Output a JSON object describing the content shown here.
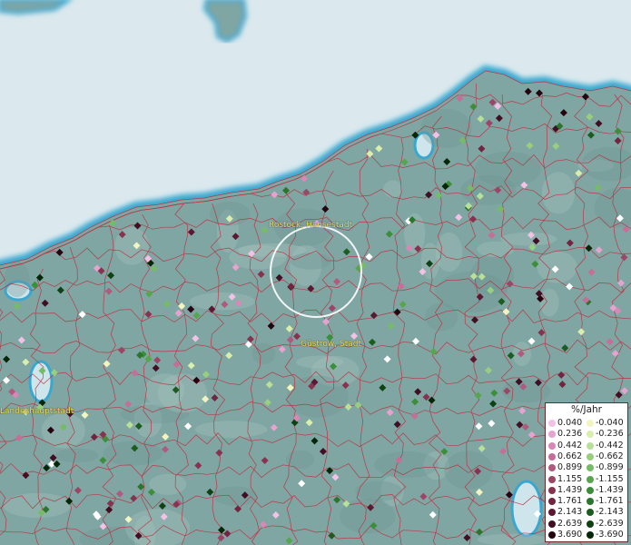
{
  "map": {
    "labels": {
      "rostock": "Rostock, Hansestadt",
      "guestrow": "Güstrow, Stadt",
      "schwerin": "Landeshauptstadt"
    },
    "colors": {
      "sea": "#dbe9ee",
      "coast": "#3aa7cf",
      "land": "#7fa6a3",
      "borders": "#c0283a",
      "label_text": "#e9e25a"
    },
    "points": {
      "count_approx": 300,
      "encoding": "diamond markers colored by rate of change %/Jahr"
    }
  },
  "legend": {
    "title": "%/Jahr",
    "positive": [
      {
        "label": "0.040",
        "color": "#f2c2e6"
      },
      {
        "label": "0.236",
        "color": "#e5a3cf"
      },
      {
        "label": "0.442",
        "color": "#d888b6"
      },
      {
        "label": "0.662",
        "color": "#c56e98"
      },
      {
        "label": "0.899",
        "color": "#b05a7e"
      },
      {
        "label": "1.155",
        "color": "#9c4566"
      },
      {
        "label": "1.439",
        "color": "#873350"
      },
      {
        "label": "1.761",
        "color": "#722440"
      },
      {
        "label": "2.143",
        "color": "#5b1832"
      },
      {
        "label": "2.639",
        "color": "#420e23"
      },
      {
        "label": "3.690",
        "color": "#250410"
      }
    ],
    "negative": [
      {
        "label": "-0.040",
        "color": "#f2f5bf"
      },
      {
        "label": "-0.236",
        "color": "#d8eeac"
      },
      {
        "label": "-0.442",
        "color": "#b9e098"
      },
      {
        "label": "-0.662",
        "color": "#98cf7f"
      },
      {
        "label": "-0.899",
        "color": "#76bc66"
      },
      {
        "label": "-1.155",
        "color": "#57a64e"
      },
      {
        "label": "-1.439",
        "color": "#3c8e3a"
      },
      {
        "label": "-1.761",
        "color": "#2a762c"
      },
      {
        "label": "-2.143",
        "color": "#1c5d1f"
      },
      {
        "label": "-2.639",
        "color": "#0f4213"
      },
      {
        "label": "-3.690",
        "color": "#052607"
      }
    ]
  }
}
